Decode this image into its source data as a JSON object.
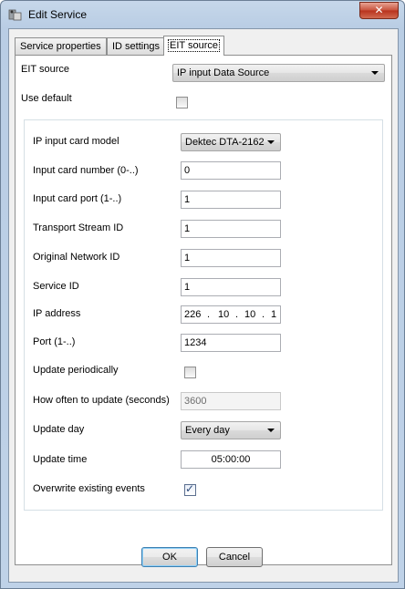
{
  "window": {
    "title": "Edit Service",
    "close_glyph": "✕"
  },
  "tabs": [
    {
      "label": "Service properties"
    },
    {
      "label": "ID settings"
    },
    {
      "label": "EIT source"
    }
  ],
  "eit_source": {
    "label": "EIT source",
    "value": "IP input Data Source",
    "use_default_label": "Use default",
    "use_default_checked": false
  },
  "settings": {
    "card_model": {
      "label": "IP input card model",
      "value": "Dektec DTA-2162"
    },
    "card_number": {
      "label": "Input card number (0-..)",
      "value": "0"
    },
    "card_port": {
      "label": "Input card port (1-..)",
      "value": "1"
    },
    "ts_id": {
      "label": "Transport Stream ID",
      "value": "1"
    },
    "onid": {
      "label": "Original Network ID",
      "value": "1"
    },
    "service_id": {
      "label": "Service ID",
      "value": "1"
    },
    "ip": {
      "label": "IP address",
      "octets": [
        "226",
        "10",
        "10",
        "1"
      ],
      "sep": "."
    },
    "port": {
      "label": "Port (1-..)",
      "value": "1234"
    },
    "update_periodically": {
      "label": "Update periodically",
      "checked": false
    },
    "how_often": {
      "label": "How often to update (seconds)",
      "value": "3600"
    },
    "update_day": {
      "label": "Update day",
      "value": "Every day"
    },
    "update_time": {
      "label": "Update time",
      "value": "05:00:00"
    },
    "overwrite": {
      "label": "Overwrite existing events",
      "checked": true,
      "tick": "✓"
    }
  },
  "buttons": {
    "ok": "OK",
    "cancel": "Cancel"
  }
}
